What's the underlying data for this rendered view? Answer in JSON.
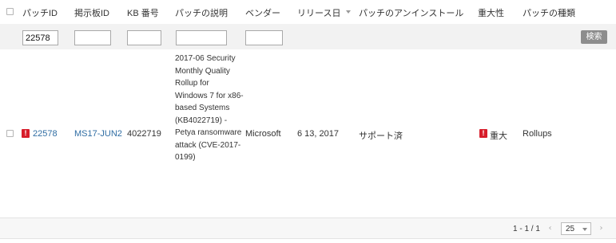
{
  "columns": {
    "patch_id": "パッチID",
    "bulletin_id": "掲示板ID",
    "kb_number": "KB 番号",
    "description": "パッチの説明",
    "vendor": "ベンダー",
    "release_date": "リリース日",
    "uninstall": "パッチのアンインストール",
    "severity": "重大性",
    "patch_type": "パッチの種類"
  },
  "filters": {
    "patch_id_value": "22578",
    "bulletin_id_value": "",
    "kb_number_value": "",
    "description_value": "",
    "vendor_value": "",
    "search_label": "検索"
  },
  "rows": [
    {
      "patch_id": "22578",
      "bulletin_id": "MS17-JUN2",
      "kb_number": "4022719",
      "description": "2017-06 Security Monthly Quality Rollup for Windows 7 for x86-based Systems (KB4022719) - Petya ransomware attack (CVE-2017-0199)",
      "vendor": "Microsoft",
      "release_date": "6 13, 2017",
      "uninstall": "サポート済",
      "severity": "重大",
      "patch_type": "Rollups"
    }
  ],
  "pagination": {
    "range": "1 - 1 / 1",
    "page_size": "25",
    "prev_icon": "chevron-left-icon",
    "next_icon": "chevron-right-icon"
  },
  "colors": {
    "alert": "#d71d2a",
    "link": "#2f6da3",
    "search_button": "#8d8d8d"
  }
}
